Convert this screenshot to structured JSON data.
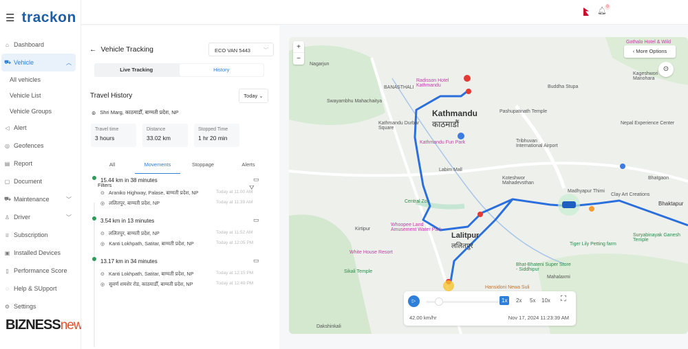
{
  "app": {
    "brand": "trackon",
    "watermark": "BIZNESS news",
    "watermark_b": "BIZNESS",
    "watermark_n": "news",
    "notification_count": "0"
  },
  "sidebar": {
    "items": [
      {
        "label": "Dashboard",
        "icon": "home-icon"
      },
      {
        "label": "Vehicle",
        "icon": "truck-icon",
        "active": true,
        "expanded": true,
        "children": [
          "All vehicles",
          "Vehicle List",
          "Vehicle Groups"
        ]
      },
      {
        "label": "Alert",
        "icon": "megaphone-icon"
      },
      {
        "label": "Geofences",
        "icon": "geofence-icon"
      },
      {
        "label": "Report",
        "icon": "report-icon"
      },
      {
        "label": "Document",
        "icon": "document-icon"
      },
      {
        "label": "Maintenance",
        "icon": "truck-icon",
        "expandable": true
      },
      {
        "label": "Driver",
        "icon": "user-icon",
        "expandable": true
      },
      {
        "label": "Subscription",
        "icon": "crown-icon"
      },
      {
        "label": "Installed Devices",
        "icon": "device-icon"
      },
      {
        "label": "Performance Score",
        "icon": "score-icon"
      },
      {
        "label": "Help & SUpport",
        "icon": "support-icon"
      },
      {
        "label": "Settings",
        "icon": "gear-icon"
      }
    ]
  },
  "panel": {
    "title": "Vehicle Tracking",
    "vehicle_select": "ECO VAN 5443",
    "modes": [
      "Live Tracking",
      "History"
    ],
    "active_mode": "History",
    "section_title": "Travel History",
    "date_filter": "Today",
    "location": "Shri Marg, काठमाडौँ, बाग्मती प्रदेश, NP",
    "stats": [
      {
        "label": "Travel time",
        "value": "3 hours"
      },
      {
        "label": "Distance",
        "value": "33.02 km"
      },
      {
        "label": "Stopped Time",
        "value": "1 hr 20 min"
      }
    ],
    "tabs": [
      "All",
      "Movements",
      "Stoppage",
      "Alerts"
    ],
    "active_tab": "Movements",
    "filters_label": "Filters",
    "movements": [
      {
        "summary": "15.44 km in 38 minutes",
        "from": "Araniko Highway, Palase, बाग्मती प्रदेश, NP",
        "from_time": "Today at 11:00 AM",
        "to": "ललितपुर, बाग्मती प्रदेश, NP",
        "to_time": "Today at 11:39 AM"
      },
      {
        "summary": "3.54 km in 13 minutes",
        "from": "ललितपुर, बाग्मती प्रदेश, NP",
        "from_time": "Today at 11:52 AM",
        "to": "Kanti Lokhpath, Satitar, बाग्मती प्रदेश, NP",
        "to_time": "Today at 12:05 PM"
      },
      {
        "summary": "13.17 km in 34 minutes",
        "from": "Kanti Lokhpath, Satitar, बाग्मती प्रदेश, NP",
        "from_time": "Today at 12:15 PM",
        "to": "सुवर्ण शमशेर रोड, काठमाडौँ, बाग्मती प्रदेश, NP",
        "to_time": "Today at 12:49 PM"
      }
    ]
  },
  "map": {
    "more_options": "More Options",
    "zoom_in": "+",
    "zoom_out": "−",
    "labels": {
      "kathmandu": "Kathmandu",
      "kathmandu_np": "काठमाडौं",
      "lalitpur": "Lalitpur",
      "lalitpur_np": "ललितपुर",
      "kirtipur": "Kirtipur",
      "thimi": "Madhyapur Thimi",
      "bhaktapur": "Bhaktapur",
      "bhatgaon": "Bhatgaon",
      "kageshwori": "Kageshwori Manohara",
      "nagarjun": "Nagarjun",
      "banasthali": "BANASTHALI",
      "swayambhu": "Swayambhu Mahachaitya",
      "boudha": "Buddha Stupa",
      "pashupati": "Pashupatinath Temple",
      "tribhuvan": "Tribhuvan International Airport",
      "durbar": "Kathmandu Durbar Square",
      "funpark": "Kathmandu Fun Park",
      "koteshwor": "Koteshwor Mahadevsthan",
      "labim": "Labim Mall",
      "central_zoo": "Central Zoo",
      "whoopee": "Whoopee Land Amusement Water Park",
      "white_house": "White House Resort",
      "sikali": "Sikali Temple",
      "tiger_lily": "Tiger Lily Petting farm",
      "mahalaxmi": "Mahalaxmi",
      "suryabinayak": "Suryabinayak Ganesh Temple",
      "gothalo": "Gothalo Hotel & Wild",
      "radisson": "Radisson Hotel Kathmandu",
      "clay_art": "Clay Art Creations",
      "hansidoni": "Hansidoni Newa Suli",
      "dakshinkali": "Dakshinkali",
      "nepal_experience": "Nepal Experience Center",
      "bhat_bhateni": "Bhat-Bhateni Super Store - Siddhipur"
    },
    "route_color": "#2a6fdb",
    "player": {
      "speeds": [
        "1x",
        "2x",
        "5x",
        "10x"
      ],
      "active_speed": "1x",
      "speed": "42.00 km/hr",
      "datetime": "Nov 17, 2024 11:23:39 AM",
      "progress": 0.17
    }
  }
}
